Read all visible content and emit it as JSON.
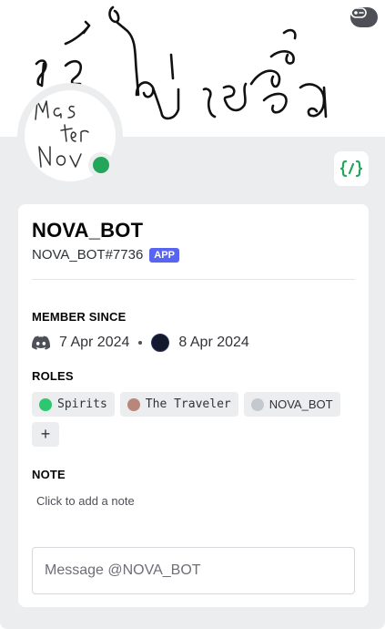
{
  "banner": {
    "handwriting": "ยังไม่เสร็จ"
  },
  "avatar": {
    "handwriting": "Mas ter Nov"
  },
  "user": {
    "display_name": "NOVA_BOT",
    "tag": "NOVA_BOT#7736",
    "app_badge": "APP"
  },
  "member_since": {
    "title": "MEMBER SINCE",
    "discord_date": "7 Apr 2024",
    "server_date": "8 Apr 2024"
  },
  "roles": {
    "title": "ROLES",
    "items": [
      {
        "name": "Spirits",
        "color": "#2dc770"
      },
      {
        "name": "The Traveler",
        "color": "#b8867b"
      },
      {
        "name": "NOVA_BOT",
        "color": "#c4c9ce"
      }
    ],
    "add_label": "+"
  },
  "note": {
    "title": "NOTE",
    "placeholder": "Click to add a note"
  },
  "message": {
    "placeholder": "Message @NOVA_BOT"
  },
  "colors": {
    "status_online": "#23a55a",
    "app_badge_bg": "#5865f2",
    "dev_badge": "#23a55a"
  },
  "icons": {
    "banner_button": "game-controller-icon",
    "dev_badge": "slash-commands-icon",
    "discord": "discord-logo-icon",
    "server": "server-icon"
  }
}
